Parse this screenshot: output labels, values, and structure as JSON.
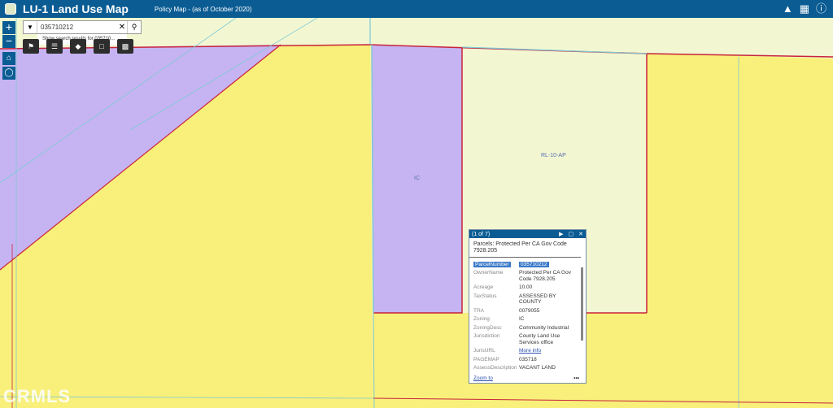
{
  "header": {
    "title": "LU-1 Land Use Map",
    "subtitle": "Policy Map - (as of October 2020)",
    "icons": [
      "mortarboard-icon",
      "grid-icon",
      "info-icon"
    ]
  },
  "zoom": {
    "plus": "+",
    "minus": "−"
  },
  "search": {
    "value": "035710212",
    "suggestion": "Show search results for 035710..."
  },
  "map_labels": {
    "ic": "IC",
    "rl": "RL-10-AP"
  },
  "colors": {
    "header": "#0a5c93",
    "rural_yellow": "#f7f3b0",
    "bright_yellow": "#f8f07a",
    "pale_green": "#f2f7d2",
    "industrial_purple": "#c6b4f2",
    "parcel_red": "#c8223c",
    "parcel_cyan": "#7fc9d4"
  },
  "popup": {
    "counter": "(1 of 7)",
    "title": "Parcels: Protected Per CA Gov Code 7928.205",
    "rows": [
      {
        "key": "ParcelNumber",
        "value": "035710212"
      },
      {
        "key": "OwnerName",
        "value": "Protected Per CA Gov Code 7928.205"
      },
      {
        "key": "Acreage",
        "value": "10.00"
      },
      {
        "key": "TaxStatus",
        "value": "ASSESSED BY COUNTY"
      },
      {
        "key": "TRA",
        "value": "0079055"
      },
      {
        "key": "Zoning",
        "value": "IC"
      },
      {
        "key": "ZoningDesc",
        "value": "Community Industrial"
      },
      {
        "key": "Jurisdiction",
        "value": "County Land Use Services office"
      },
      {
        "key": "JurisURL",
        "value": "More info"
      },
      {
        "key": "PAGEMAP",
        "value": "035718"
      },
      {
        "key": "AssessDescription",
        "value": "VACANT LAND"
      }
    ],
    "zoom_to": "Zoom to",
    "more": "•••"
  },
  "watermark": "CRMLS"
}
